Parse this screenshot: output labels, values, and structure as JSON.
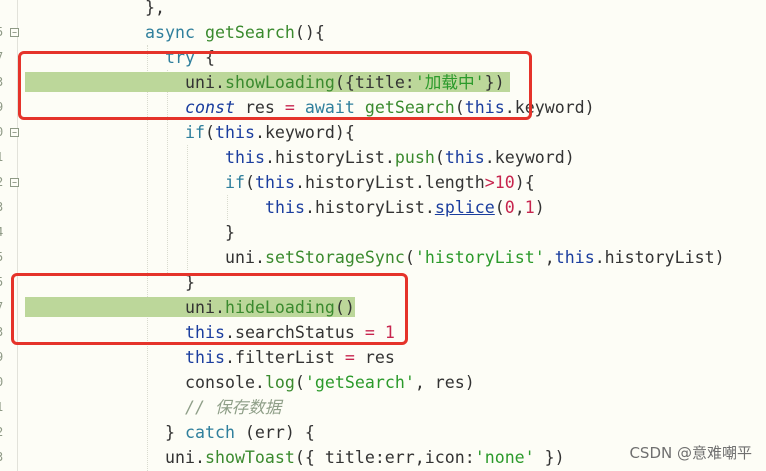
{
  "editor": {
    "gutter_numbers": [
      "",
      "",
      "5",
      "7",
      "3",
      "9",
      "0",
      "1",
      "2",
      "3",
      "4",
      "5",
      "5",
      "7",
      "3",
      "9",
      "0",
      "1",
      "2",
      "3"
    ],
    "lines": [
      {
        "text": "},"
      },
      {
        "text": "async getSearch(){"
      },
      {
        "text": "try {"
      },
      {
        "text": "uni.showLoading({title:'加载中'})"
      },
      {
        "text": "const res = await getSearch(this.keyword)"
      },
      {
        "text": "if(this.keyword){"
      },
      {
        "text": "this.historyList.push(this.keyword)"
      },
      {
        "text": "if(this.historyList.length>10){"
      },
      {
        "text": "this.historyList.splice(0,1)"
      },
      {
        "text": "}"
      },
      {
        "text": "uni.setStorageSync('historyList',this.historyList)"
      },
      {
        "text": "}"
      },
      {
        "text": "uni.hideLoading()"
      },
      {
        "text": "this.searchStatus = 1"
      },
      {
        "text": "this.filterList = res"
      },
      {
        "text": "console.log('getSearch', res)"
      },
      {
        "text": "// 保存数据"
      },
      {
        "text": "} catch (err) {"
      },
      {
        "text": "uni.showToast({ title:err,icon:'none' })"
      }
    ]
  },
  "watermark": "CSDN @意难嘲平"
}
